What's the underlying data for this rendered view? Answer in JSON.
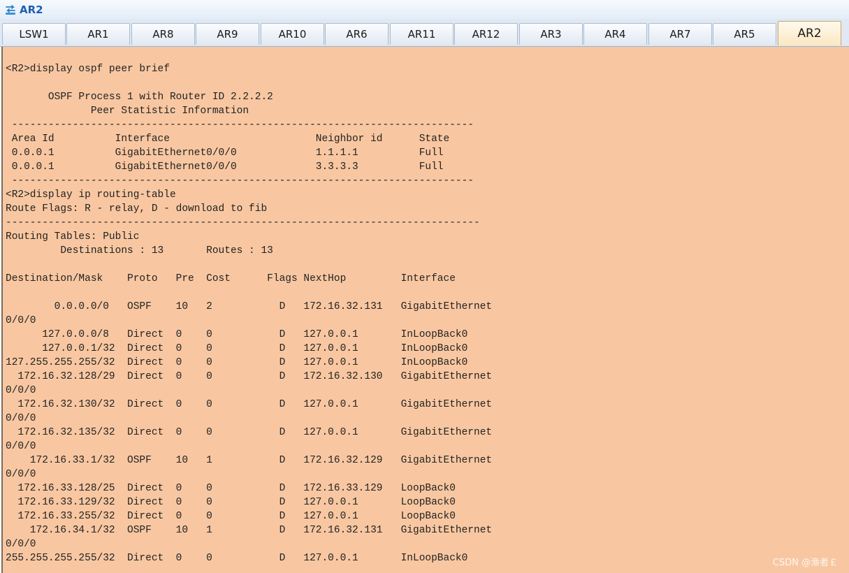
{
  "window": {
    "title": "AR2",
    "icon": "network-device-icon"
  },
  "tabs": [
    {
      "label": "LSW1"
    },
    {
      "label": "AR1"
    },
    {
      "label": "AR8"
    },
    {
      "label": "AR9"
    },
    {
      "label": "AR10"
    },
    {
      "label": "AR6"
    },
    {
      "label": "AR11"
    },
    {
      "label": "AR12"
    },
    {
      "label": "AR3"
    },
    {
      "label": "AR4"
    },
    {
      "label": "AR7"
    },
    {
      "label": "AR5"
    },
    {
      "label": "AR2",
      "active": true
    }
  ],
  "console": {
    "background_color": "#f8c7a1",
    "lines": [
      "<R2>display ospf peer brief",
      "",
      "       OSPF Process 1 with Router ID 2.2.2.2",
      "              Peer Statistic Information",
      " ----------------------------------------------------------------------------",
      " Area Id          Interface                        Neighbor id      State",
      " 0.0.0.1          GigabitEthernet0/0/0             1.1.1.1          Full",
      " 0.0.0.1          GigabitEthernet0/0/0             3.3.3.3          Full",
      " ----------------------------------------------------------------------------",
      "<R2>display ip routing-table",
      "Route Flags: R - relay, D - download to fib",
      "------------------------------------------------------------------------------",
      "Routing Tables: Public",
      "         Destinations : 13       Routes : 13",
      "",
      "Destination/Mask    Proto   Pre  Cost      Flags NextHop         Interface",
      "",
      "        0.0.0.0/0   OSPF    10   2           D   172.16.32.131   GigabitEthernet",
      "0/0/0",
      "      127.0.0.0/8   Direct  0    0           D   127.0.0.1       InLoopBack0",
      "      127.0.0.1/32  Direct  0    0           D   127.0.0.1       InLoopBack0",
      "127.255.255.255/32  Direct  0    0           D   127.0.0.1       InLoopBack0",
      "  172.16.32.128/29  Direct  0    0           D   172.16.32.130   GigabitEthernet",
      "0/0/0",
      "  172.16.32.130/32  Direct  0    0           D   127.0.0.1       GigabitEthernet",
      "0/0/0",
      "  172.16.32.135/32  Direct  0    0           D   127.0.0.1       GigabitEthernet",
      "0/0/0",
      "    172.16.33.1/32  OSPF    10   1           D   172.16.32.129   GigabitEthernet",
      "0/0/0",
      "  172.16.33.128/25  Direct  0    0           D   172.16.33.129   LoopBack0",
      "  172.16.33.129/32  Direct  0    0           D   127.0.0.1       LoopBack0",
      "  172.16.33.255/32  Direct  0    0           D   127.0.0.1       LoopBack0",
      "    172.16.34.1/32  OSPF    10   1           D   172.16.32.131   GigabitEthernet",
      "0/0/0",
      "255.255.255.255/32  Direct  0    0           D   127.0.0.1       InLoopBack0"
    ]
  },
  "watermark": "CSDN @渔者￡"
}
